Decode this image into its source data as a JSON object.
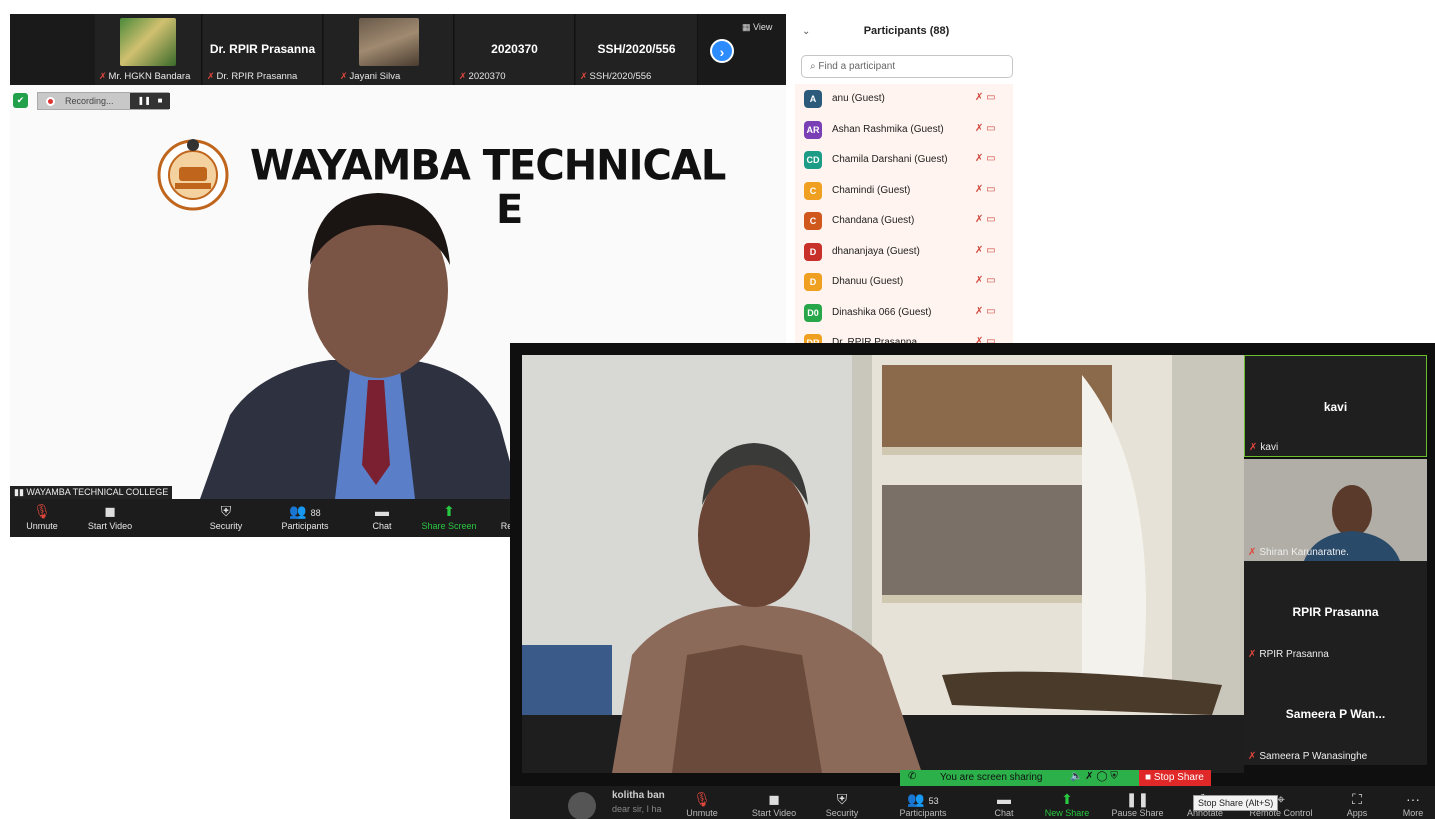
{
  "meeting1": {
    "strip": {
      "tiles": [
        {
          "name": "",
          "label": "Mr. HGKN Bandara"
        },
        {
          "name": "Dr. RPIR Prasanna",
          "label": "Dr. RPIR Prasanna"
        },
        {
          "name": "",
          "label": "Jayani Silva"
        },
        {
          "name": "2020370",
          "label": "2020370"
        },
        {
          "name": "SSH/2020/556",
          "label": "SSH/2020/556"
        }
      ],
      "next_icon": "chevron-right-icon",
      "view_label": "View"
    },
    "recording": {
      "label": "Recording..."
    },
    "slide": {
      "line1": "WAYAMBA TECHNICAL",
      "line2": "E"
    },
    "speaker_label": "WAYAMBA TECHNICAL COLLEGE",
    "toolbar": {
      "unmute": "Unmute",
      "start_video": "Start Video",
      "security": "Security",
      "participants": "Participants",
      "participants_count": "88",
      "chat": "Chat",
      "share_screen": "Share Screen",
      "more_partial": "Rea"
    }
  },
  "participants_panel": {
    "title": "Participants (88)",
    "search_placeholder": "Find a participant",
    "rows": [
      {
        "initials": "A",
        "name": "anu (Guest)",
        "color": "#2b5a7a"
      },
      {
        "initials": "AR",
        "name": "Ashan Rashmika (Guest)",
        "color": "#7b3fb5"
      },
      {
        "initials": "CD",
        "name": "Chamila Darshani (Guest)",
        "color": "#1c9c86"
      },
      {
        "initials": "C",
        "name": "Chamindi (Guest)",
        "color": "#f0a020"
      },
      {
        "initials": "C",
        "name": "Chandana (Guest)",
        "color": "#d0581c"
      },
      {
        "initials": "D",
        "name": "dhananjaya (Guest)",
        "color": "#c8302a"
      },
      {
        "initials": "D",
        "name": "Dhanuu (Guest)",
        "color": "#f0a020"
      },
      {
        "initials": "D0",
        "name": "Dinashika 066 (Guest)",
        "color": "#27a64a"
      },
      {
        "initials": "DR",
        "name": "Dr. RPIR Prasanna",
        "color": "#f0a020"
      }
    ]
  },
  "meeting2": {
    "gallery": [
      {
        "name": "kavi",
        "label": "kavi"
      },
      {
        "name": "",
        "label": "Shiran Karunaratne."
      },
      {
        "name": "RPIR Prasanna",
        "label": "RPIR Prasanna"
      },
      {
        "name": "Sameera P Wan...",
        "label": "Sameera P Wanasinghe"
      }
    ],
    "share": {
      "status": "You are screen sharing",
      "stop": "Stop Share"
    },
    "tooltip": "Stop Share (Alt+S)",
    "chat_preview": {
      "name": "kolitha ban",
      "message": "dear sir, I ha"
    },
    "toolbar": {
      "unmute": "Unmute",
      "start_video": "Start Video",
      "security": "Security",
      "participants": "Participants",
      "participants_count": "53",
      "chat": "Chat",
      "new_share": "New Share",
      "pause_share": "Pause Share",
      "annotate": "Annotate",
      "remote_control": "Remote Control",
      "apps": "Apps",
      "more": "More"
    }
  }
}
